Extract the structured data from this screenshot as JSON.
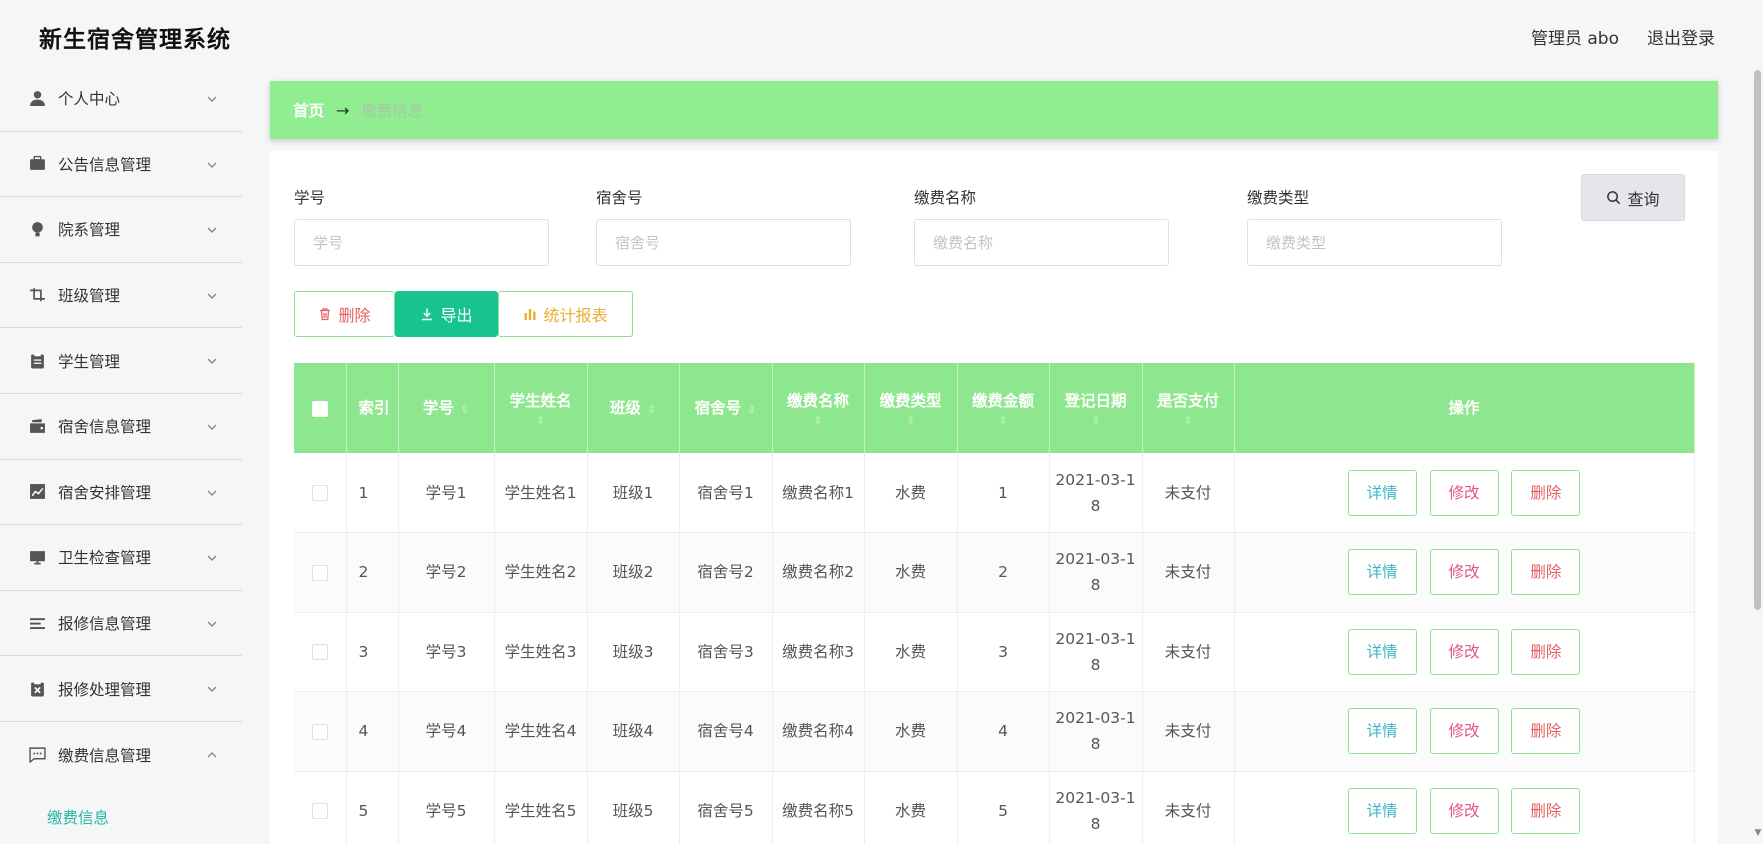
{
  "app": {
    "title": "新生宿舍管理系统",
    "user": "管理员 abo",
    "logout": "退出登录"
  },
  "sidebar": {
    "items": [
      {
        "label": "个人中心",
        "icon": "user-icon"
      },
      {
        "label": "公告信息管理",
        "icon": "briefcase-icon"
      },
      {
        "label": "院系管理",
        "icon": "lightbulb-icon"
      },
      {
        "label": "班级管理",
        "icon": "crop-icon"
      },
      {
        "label": "学生管理",
        "icon": "clipboard-icon"
      },
      {
        "label": "宿舍信息管理",
        "icon": "wallet-icon"
      },
      {
        "label": "宿舍安排管理",
        "icon": "chart-icon"
      },
      {
        "label": "卫生检查管理",
        "icon": "monitor-icon"
      },
      {
        "label": "报修信息管理",
        "icon": "list-icon"
      },
      {
        "label": "报修处理管理",
        "icon": "clipboard-x-icon"
      },
      {
        "label": "缴费信息管理",
        "icon": "message-icon"
      }
    ],
    "sub_item": "缴费信息"
  },
  "breadcrumb": {
    "home": "首页",
    "arrow": "→",
    "current": "缴费信息"
  },
  "search": {
    "fields": [
      {
        "label": "学号",
        "placeholder": "学号"
      },
      {
        "label": "宿舍号",
        "placeholder": "宿舍号"
      },
      {
        "label": "缴费名称",
        "placeholder": "缴费名称"
      },
      {
        "label": "缴费类型",
        "placeholder": "缴费类型"
      }
    ],
    "query": "查询"
  },
  "actions": {
    "delete": "删除",
    "export": "导出",
    "report": "统计报表"
  },
  "table": {
    "headers": {
      "index": "索引",
      "student_no": "学号",
      "student_name": "学生姓名",
      "class": "班级",
      "dorm": "宿舍号",
      "fee_name": "缴费名称",
      "fee_type": "缴费类型",
      "amount": "缴费金额",
      "date": "登记日期",
      "paid": "是否支付",
      "ops": "操作"
    },
    "sort_glyph": "⇕",
    "ops": {
      "detail": "详情",
      "edit": "修改",
      "delete": "删除"
    },
    "rows": [
      {
        "index": "1",
        "student_no": "学号1",
        "student_name": "学生姓名1",
        "class": "班级1",
        "dorm": "宿舍号1",
        "fee_name": "缴费名称1",
        "fee_type": "水费",
        "amount": "1",
        "date_a": "2021-03-1",
        "date_b": "8",
        "paid": "未支付"
      },
      {
        "index": "2",
        "student_no": "学号2",
        "student_name": "学生姓名2",
        "class": "班级2",
        "dorm": "宿舍号2",
        "fee_name": "缴费名称2",
        "fee_type": "水费",
        "amount": "2",
        "date_a": "2021-03-1",
        "date_b": "8",
        "paid": "未支付"
      },
      {
        "index": "3",
        "student_no": "学号3",
        "student_name": "学生姓名3",
        "class": "班级3",
        "dorm": "宿舍号3",
        "fee_name": "缴费名称3",
        "fee_type": "水费",
        "amount": "3",
        "date_a": "2021-03-1",
        "date_b": "8",
        "paid": "未支付"
      },
      {
        "index": "4",
        "student_no": "学号4",
        "student_name": "学生姓名4",
        "class": "班级4",
        "dorm": "宿舍号4",
        "fee_name": "缴费名称4",
        "fee_type": "水费",
        "amount": "4",
        "date_a": "2021-03-1",
        "date_b": "8",
        "paid": "未支付"
      },
      {
        "index": "5",
        "student_no": "学号5",
        "student_name": "学生姓名5",
        "class": "班级5",
        "dorm": "宿舍号5",
        "fee_name": "缴费名称5",
        "fee_type": "水费",
        "amount": "5",
        "date_a": "2021-03-1",
        "date_b": "8",
        "paid": "未支付"
      }
    ]
  },
  "colors": {
    "accent_green": "#90ee90",
    "export_green": "#17c38e",
    "submenu_teal": "#2ab3a5"
  }
}
